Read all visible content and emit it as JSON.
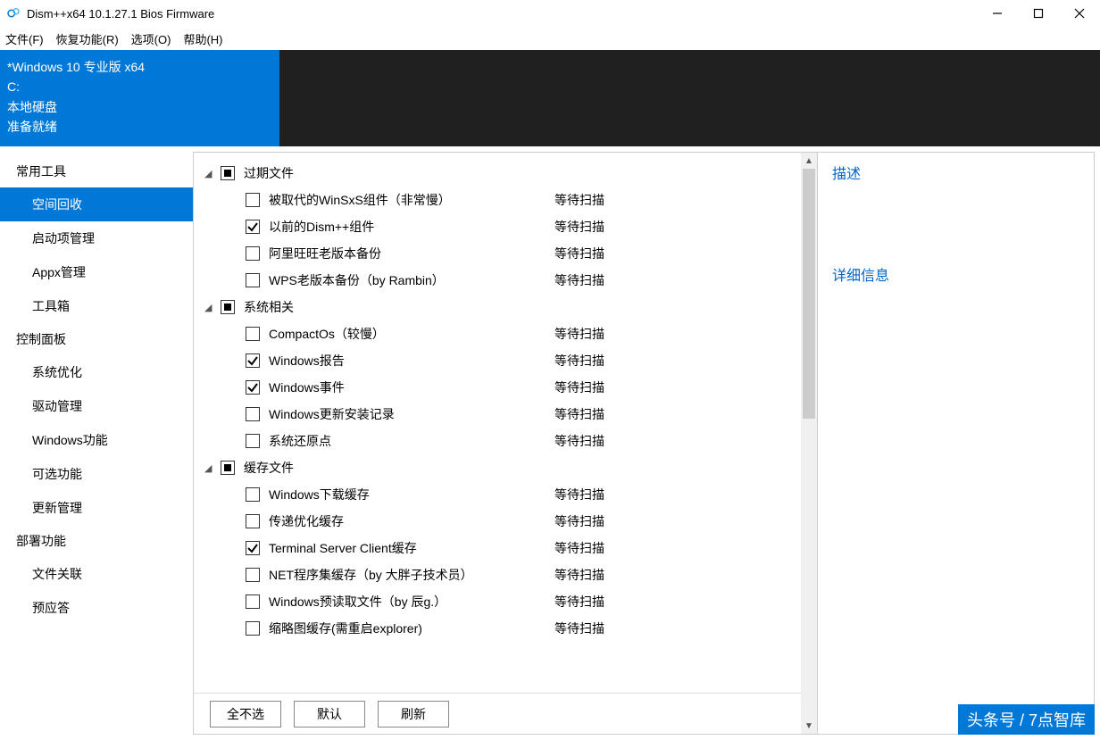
{
  "window": {
    "title": "Dism++x64 10.1.27.1 Bios Firmware"
  },
  "menu": {
    "file": "文件(F)",
    "restore": "恢复功能(R)",
    "options": "选项(O)",
    "help": "帮助(H)"
  },
  "banner": {
    "os": "*Windows 10 专业版 x64",
    "drive": "C:",
    "disk_type": "本地硬盘",
    "status": "准备就绪"
  },
  "nav": {
    "g1": "常用工具",
    "g1_items": {
      "space_cleanup": "空间回收",
      "startup": "启动项管理",
      "appx": "Appx管理",
      "toolbox": "工具箱"
    },
    "g2": "控制面板",
    "g2_items": {
      "sys_opt": "系统优化",
      "driver": "驱动管理",
      "winfeat": "Windows功能",
      "optfeat": "可选功能",
      "update": "更新管理"
    },
    "g3": "部署功能",
    "g3_items": {
      "file_assoc": "文件关联",
      "sysprep": "预应答"
    }
  },
  "groups": [
    {
      "name": "过期文件",
      "items": [
        {
          "label": "被取代的WinSxS组件（非常慢）",
          "status": "等待扫描",
          "checked": false
        },
        {
          "label": "以前的Dism++组件",
          "status": "等待扫描",
          "checked": true
        },
        {
          "label": "阿里旺旺老版本备份",
          "status": "等待扫描",
          "checked": false
        },
        {
          "label": "WPS老版本备份（by Rambin）",
          "status": "等待扫描",
          "checked": false
        }
      ]
    },
    {
      "name": "系统相关",
      "items": [
        {
          "label": "CompactOs（较慢）",
          "status": "等待扫描",
          "checked": false
        },
        {
          "label": "Windows报告",
          "status": "等待扫描",
          "checked": true
        },
        {
          "label": "Windows事件",
          "status": "等待扫描",
          "checked": true
        },
        {
          "label": "Windows更新安装记录",
          "status": "等待扫描",
          "checked": false
        },
        {
          "label": "系统还原点",
          "status": "等待扫描",
          "checked": false
        }
      ]
    },
    {
      "name": "缓存文件",
      "items": [
        {
          "label": "Windows下载缓存",
          "status": "等待扫描",
          "checked": false
        },
        {
          "label": "传递优化缓存",
          "status": "等待扫描",
          "checked": false
        },
        {
          "label": "Terminal Server Client缓存",
          "status": "等待扫描",
          "checked": true
        },
        {
          "label": "NET程序集缓存（by 大胖子技术员）",
          "status": "等待扫描",
          "checked": false
        },
        {
          "label": "Windows预读取文件（by 辰g.）",
          "status": "等待扫描",
          "checked": false
        },
        {
          "label": "缩略图缓存(需重启explorer)",
          "status": "等待扫描",
          "checked": false
        }
      ]
    }
  ],
  "right": {
    "desc": "描述",
    "detail": "详细信息"
  },
  "actions": {
    "deselect_all": "全不选",
    "default": "默认",
    "refresh": "刷新"
  },
  "watermark": "头条号 / 7点智库"
}
